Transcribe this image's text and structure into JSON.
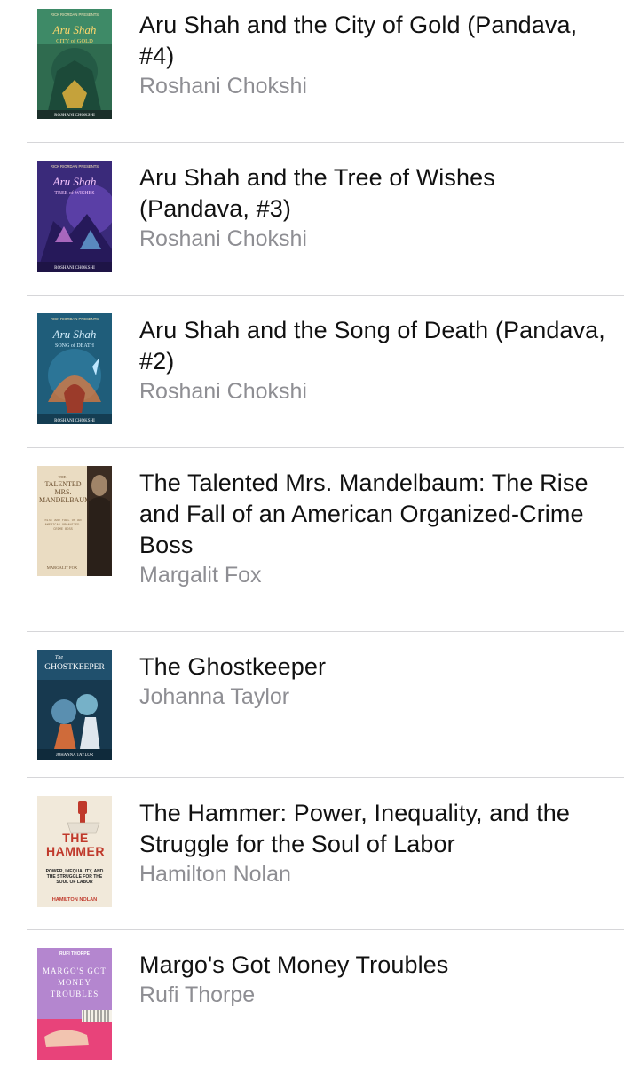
{
  "books": [
    {
      "title": "Aru Shah and the City of Gold (Pandava, #4)",
      "author": "Roshani Chokshi",
      "cover": {
        "icon": "book-cover-aru-shah-city-of-gold",
        "bg": "#2f6b4f",
        "accent": "#e3b23c",
        "top": "RICK RIORDAN PRESENTS",
        "title": "Aru Shah",
        "subtitle": "CITY of GOLD",
        "byline": "ROSHANI CHOKSHI"
      }
    },
    {
      "title": "Aru Shah and the Tree of Wishes (Pandava, #3)",
      "author": "Roshani Chokshi",
      "cover": {
        "icon": "book-cover-aru-shah-tree-of-wishes",
        "bg": "#3a2a7a",
        "accent": "#c97bd6",
        "top": "RICK RIORDAN PRESENTS",
        "title": "Aru Shah",
        "subtitle": "TREE of WISHES",
        "byline": "ROSHANI CHOKSHI"
      }
    },
    {
      "title": "Aru Shah and the Song of Death (Pandava, #2)",
      "author": "Roshani Chokshi",
      "cover": {
        "icon": "book-cover-aru-shah-song-of-death",
        "bg": "#1f5d7a",
        "accent": "#e07a3c",
        "top": "RICK RIORDAN PRESENTS",
        "title": "Aru Shah",
        "subtitle": "SONG of DEATH",
        "byline": "ROSHANI CHOKSHI"
      }
    },
    {
      "title": "The Talented Mrs. Mandelbaum: The Rise and Fall of an American Organized-Crime Boss",
      "author": "Margalit Fox",
      "cover": {
        "icon": "book-cover-talented-mrs-mandelbaum",
        "bg": "#eadcc2",
        "accent": "#6b4e2e",
        "top": "THE",
        "title": "TALENTED MRS. MANDELBAUM",
        "subtitle": "RISE AND FALL OF AN AMERICAN ORGANIZED-CRIME BOSS",
        "byline": "MARGALIT FOX"
      }
    },
    {
      "title": "The Ghostkeeper",
      "author": "Johanna Taylor",
      "cover": {
        "icon": "book-cover-ghostkeeper",
        "bg": "#17394f",
        "accent": "#8fd0e6",
        "top": "The",
        "title": "GHOSTKEEPER",
        "subtitle": "",
        "byline": "JOHANNA TAYLOR"
      }
    },
    {
      "title": "The Hammer: Power, Inequality, and the Struggle for the Soul of Labor",
      "author": "Hamilton Nolan",
      "cover": {
        "icon": "book-cover-the-hammer",
        "bg": "#f1e9da",
        "accent": "#c0392b",
        "top": "",
        "title": "THE HAMMER",
        "subtitle": "POWER, INEQUALITY, AND THE STRUGGLE FOR THE SOUL OF LABOR",
        "byline": "HAMILTON NOLAN"
      }
    },
    {
      "title": "Margo's Got Money Troubles",
      "author": "Rufi Thorpe",
      "cover": {
        "icon": "book-cover-margos-got-money-troubles",
        "bg": "#b486cf",
        "accent": "#e8437a",
        "top": "RUFI THORPE",
        "title": "MARGO'S GOT MONEY TROUBLES",
        "subtitle": "",
        "byline": ""
      }
    }
  ]
}
